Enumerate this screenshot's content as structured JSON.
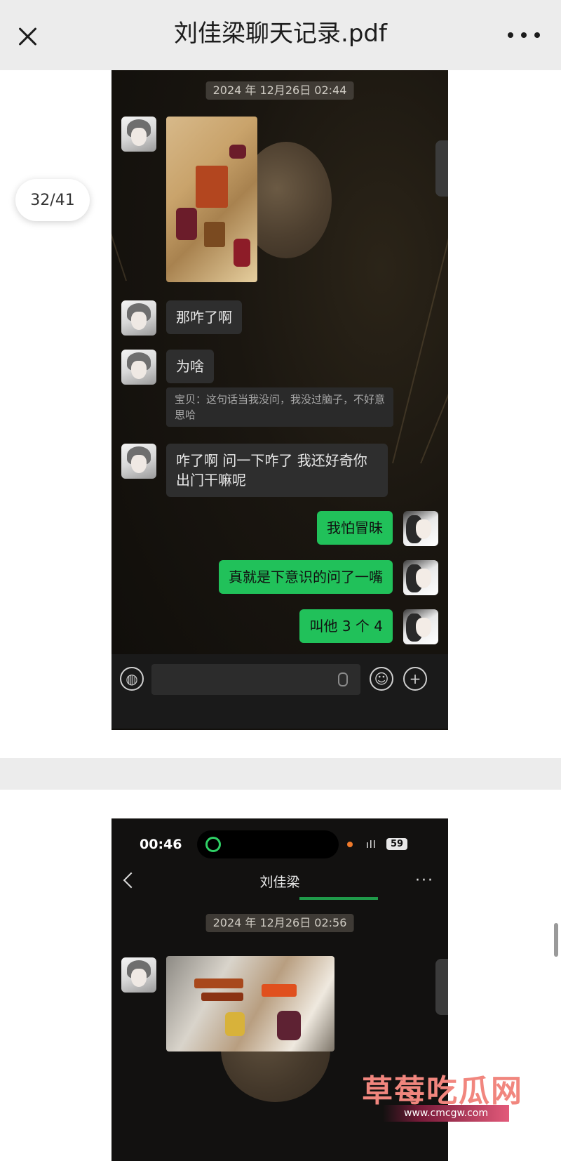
{
  "header": {
    "title": "刘佳梁聊天记录.pdf"
  },
  "page_counter": "32/41",
  "page1": {
    "date": "2024 年 12月26日 02:44",
    "messages": [
      {
        "text": "那咋了啊"
      },
      {
        "text": "为啥"
      },
      {
        "text": "宝贝：这句话当我没问，我没过脑子，不好意思哈"
      },
      {
        "text": "咋了啊 问一下咋了 我还好奇你出门干嘛呢"
      },
      {
        "text": "我怕冒昧"
      },
      {
        "text": "真就是下意识的问了一嘴"
      },
      {
        "text": "叫他 3 个 4"
      }
    ],
    "input_icons": [
      "voice-icon",
      "mic-icon",
      "emoji-icon",
      "plus-icon"
    ]
  },
  "page2": {
    "status_time": "00:46",
    "signal": "ıll",
    "battery": "59",
    "chat_name": "刘佳梁",
    "more": "···",
    "date": "2024 年 12月26日 02:56"
  },
  "watermark": {
    "text": "草莓吃瓜网",
    "url": "www.cmcgw.com"
  }
}
